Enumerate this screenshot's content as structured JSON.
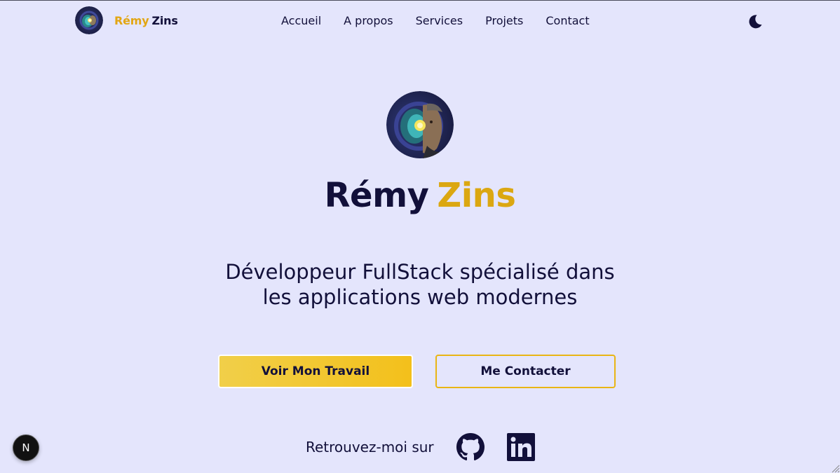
{
  "brand": {
    "first_name": "Rémy",
    "last_name": "Zins"
  },
  "nav": {
    "items": [
      {
        "label": "Accueil"
      },
      {
        "label": "A propos"
      },
      {
        "label": "Services"
      },
      {
        "label": "Projets"
      },
      {
        "label": "Contact"
      }
    ],
    "theme_icon": "moon-icon"
  },
  "hero": {
    "first_name": "Rémy",
    "last_name": "Zins",
    "subtitle_line1": "Développeur FullStack spécialisé dans",
    "subtitle_line2": "les applications web modernes",
    "primary_button": "Voir Mon Travail",
    "secondary_button": "Me Contacter"
  },
  "social": {
    "label": "Retrouvez-moi sur",
    "icons": [
      "github-icon",
      "linkedin-icon"
    ]
  },
  "dev_badge": {
    "letter": "N"
  },
  "colors": {
    "background": "#e4e5fc",
    "text": "#12103a",
    "accent": "#dba711",
    "button_gradient_start": "#f1cf49",
    "button_gradient_end": "#f3c01b"
  }
}
